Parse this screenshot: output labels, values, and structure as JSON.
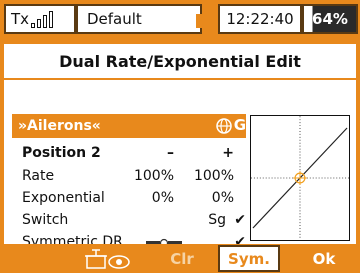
{
  "status_bar": {
    "tx_label": "Tx",
    "model_name": "Default",
    "time": "12:22:40",
    "battery": "64%",
    "battery_level": 0.64
  },
  "page": {
    "title": "Dual Rate/Exponential Edit"
  },
  "channel": {
    "name": "»Ailerons«",
    "global_icon_letter": "G"
  },
  "position_row": {
    "label": "Position 2",
    "minus": "–",
    "plus": "+"
  },
  "rate_row": {
    "label": "Rate",
    "left": "100%",
    "right": "100%"
  },
  "expo_row": {
    "label": "Exponential",
    "left": "0%",
    "right": "0%"
  },
  "switch_row": {
    "label": "Switch",
    "value": "Sg",
    "check": "✔"
  },
  "symm_row": {
    "label": "Symmetric DR",
    "check": "✔"
  },
  "bottom_bar": {
    "trim_icon": "trim-eye-icon",
    "clr_label": "Clr",
    "sym_label": "Sym.",
    "ok_label": "Ok"
  },
  "colors": {
    "accent": "#e8891c",
    "dark": "#5a3a12"
  }
}
